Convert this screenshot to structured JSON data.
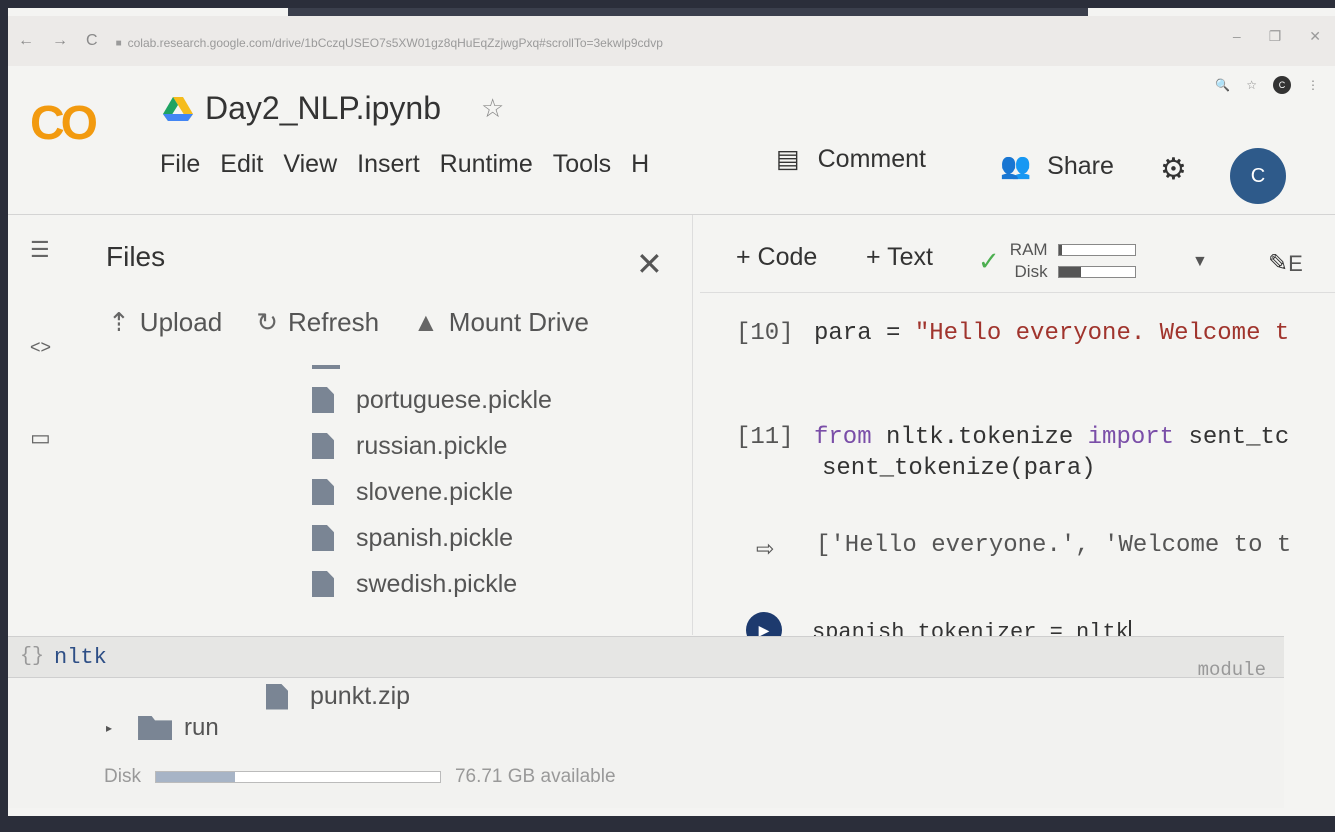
{
  "browser": {
    "url": "colab.research.google.com/drive/1bCczqUSEO7s5XW01gz8qHuEqZzjwgPxq#scrollTo=3ekwlp9cdvp"
  },
  "header": {
    "logo": "CO",
    "title": "Day2_NLP.ipynb",
    "menu": [
      "File",
      "Edit",
      "View",
      "Insert",
      "Runtime",
      "Tools",
      "H"
    ],
    "comment_label": "Comment",
    "share_label": "Share",
    "avatar_letter": "C"
  },
  "files": {
    "title": "Files",
    "actions": {
      "upload": "Upload",
      "refresh": "Refresh",
      "mount": "Mount Drive"
    },
    "items": [
      "portuguese.pickle",
      "russian.pickle",
      "slovene.pickle",
      "spanish.pickle",
      "swedish.pickle"
    ],
    "punkt_zip": "punkt.zip",
    "run_folder": "run",
    "disk_label": "Disk",
    "disk_available": "76.71 GB available",
    "disk_used_fraction": 0.28
  },
  "toolbar": {
    "code_btn": "+ Code",
    "text_btn": "+ Text",
    "ram_label": "RAM",
    "disk_label": "Disk",
    "ram_fraction": 0.05,
    "disk_fraction": 0.3,
    "edit_partial": "E"
  },
  "cells": [
    {
      "exec": "[10]",
      "line1_a": "para = ",
      "line1_str": "\"Hello everyone. Welcome t"
    },
    {
      "exec": "[11]",
      "kw_from": "from",
      "mid": " nltk.tokenize ",
      "kw_import": "import",
      "tail": " sent_tc",
      "line2": "sent_tokenize(para)"
    }
  ],
  "output": {
    "text": "['Hello everyone.', 'Welcome to t"
  },
  "active_cell": {
    "code": "spanish_tokenizer = nltk"
  },
  "autocomplete": {
    "text": "nltk",
    "type": "module"
  }
}
